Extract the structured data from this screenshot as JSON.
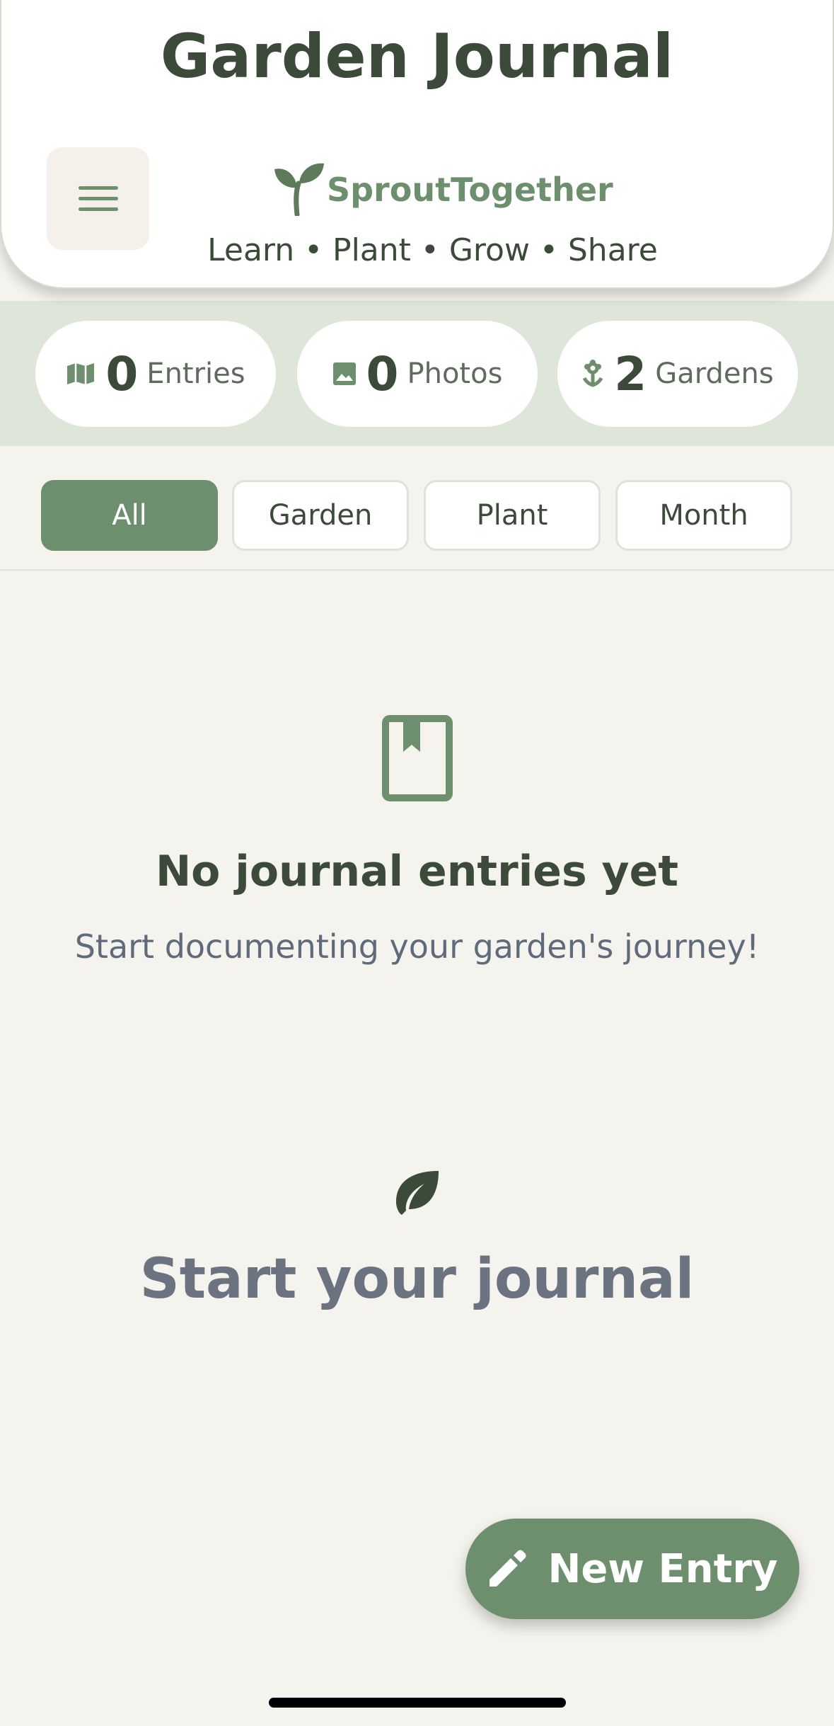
{
  "header": {
    "title": "Garden Journal",
    "brand": "SproutTogether",
    "tagline": "Learn • Plant • Grow • Share"
  },
  "stats": [
    {
      "icon": "map-book-icon",
      "value": "0",
      "label": "Entries"
    },
    {
      "icon": "photo-icon",
      "value": "0",
      "label": "Photos"
    },
    {
      "icon": "flower-icon",
      "value": "2",
      "label": "Gardens"
    }
  ],
  "filters": {
    "tabs": [
      {
        "label": "All",
        "active": true
      },
      {
        "label": "Garden",
        "active": false
      },
      {
        "label": "Plant",
        "active": false
      },
      {
        "label": "Month",
        "active": false
      }
    ]
  },
  "empty_state": {
    "title": "No journal entries yet",
    "subtitle": "Start documenting your garden's journey!",
    "cta_heading": "Start your journal"
  },
  "fab": {
    "label": "New Entry"
  },
  "colors": {
    "primary": "#6e8f6e",
    "text_dark": "#3b4a39",
    "background": "#f5f3ee",
    "stats_band": "#dde6d8"
  }
}
